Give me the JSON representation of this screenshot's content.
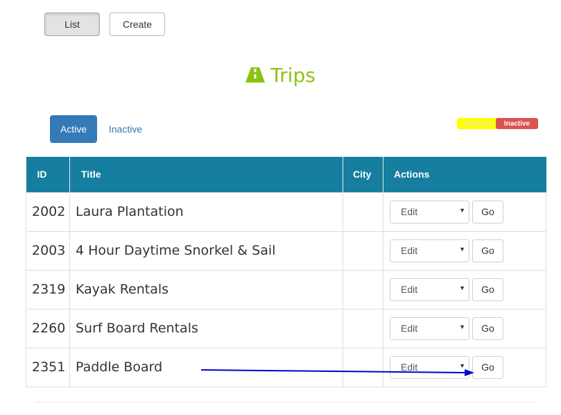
{
  "toolbar": {
    "list_label": "List",
    "create_label": "Create"
  },
  "header": {
    "title": "Trips",
    "icon": "road-icon",
    "accent": "#8cc313"
  },
  "tabs": [
    {
      "label": "Active",
      "selected": true
    },
    {
      "label": "Inactive",
      "selected": false
    }
  ],
  "legend": [
    {
      "label": "Delayed",
      "color": "#ffff00"
    },
    {
      "label": "Inactive",
      "color": "#d9534f"
    }
  ],
  "table": {
    "header_color": "#167e9f",
    "columns": [
      "ID",
      "Title",
      "City",
      "Actions"
    ],
    "rows": [
      {
        "id": "2002",
        "title": "Laura Plantation",
        "city": "",
        "action": "Edit",
        "go": "Go"
      },
      {
        "id": "2003",
        "title": "4 Hour Daytime Snorkel & Sail",
        "city": "",
        "action": "Edit",
        "go": "Go"
      },
      {
        "id": "2319",
        "title": "Kayak Rentals",
        "city": "",
        "action": "Edit",
        "go": "Go"
      },
      {
        "id": "2260",
        "title": "Surf Board Rentals",
        "city": "",
        "action": "Edit",
        "go": "Go"
      },
      {
        "id": "2351",
        "title": "Paddle Board",
        "city": "",
        "action": "Edit",
        "go": "Go"
      }
    ]
  },
  "annotation": {
    "type": "arrow",
    "color": "#0000cc",
    "points_to": "Go button of row 2351"
  }
}
